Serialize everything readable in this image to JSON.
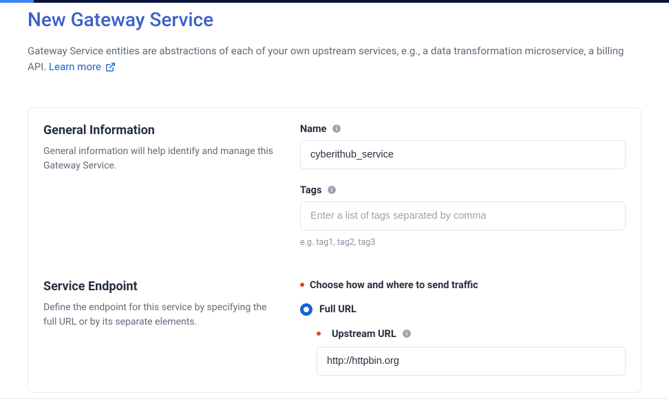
{
  "page": {
    "title": "New Gateway Service",
    "description": "Gateway Service entities are abstractions of each of your own upstream services, e.g., a data transformation microservice, a billing API.",
    "learn_more_label": "Learn more"
  },
  "general_info": {
    "heading": "General Information",
    "subtext": "General information will help identify and manage this Gateway Service.",
    "name_label": "Name",
    "name_value": "cyberithub_service",
    "tags_label": "Tags",
    "tags_placeholder": "Enter a list of tags separated by comma",
    "tags_helper": "e.g. tag1, tag2, tag3"
  },
  "service_endpoint": {
    "heading": "Service Endpoint",
    "subtext": "Define the endpoint for this service by specifying the full URL or by its separate elements.",
    "choose_label": "Choose how and where to send traffic",
    "full_url_label": "Full URL",
    "upstream_url_label": "Upstream URL",
    "upstream_url_value": "http://httpbin.org"
  }
}
